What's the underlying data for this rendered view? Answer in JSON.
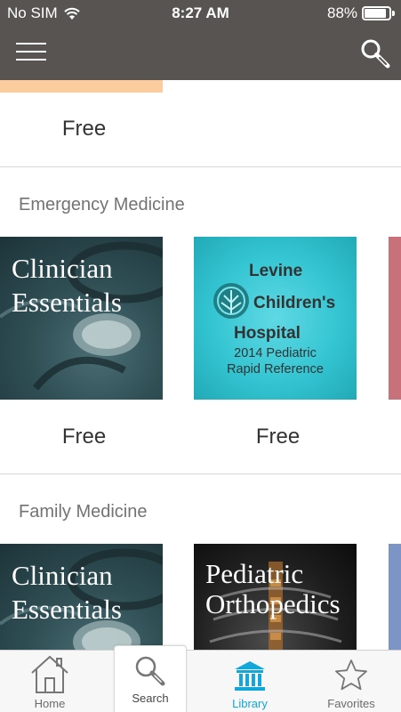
{
  "status_bar": {
    "carrier": "No SIM",
    "time": "8:27 AM",
    "battery_percent": "88%",
    "battery_level": 0.88
  },
  "nav": {
    "menu_icon": "hamburger-menu-icon",
    "search_icon": "search-icon"
  },
  "top_partial": {
    "price": "Free",
    "stripe_color": "#fbcd9e"
  },
  "sections": [
    {
      "title": "Emergency Medicine",
      "books": [
        {
          "cover_lines": [
            "Clinician",
            "Essentials"
          ],
          "price": "Free"
        },
        {
          "cover_lines": [
            "Levine",
            "Children's",
            "Hospital",
            "2014 Pediatric",
            "Rapid Reference"
          ],
          "price": "Free"
        }
      ],
      "peek_color": "#c9717a"
    },
    {
      "title": "Family Medicine",
      "books": [
        {
          "cover_lines": [
            "Clinician",
            "Essentials"
          ]
        },
        {
          "cover_lines": [
            "Pediatric",
            "Orthopedics"
          ]
        }
      ],
      "peek_color": "#7c94c6"
    }
  ],
  "tabs": [
    {
      "label": "Home",
      "icon": "home-icon"
    },
    {
      "label": "Search",
      "icon": "search-icon"
    },
    {
      "label": "Library",
      "icon": "library-icon",
      "active_color": "#13a6d9"
    },
    {
      "label": "Favorites",
      "icon": "star-icon"
    }
  ]
}
